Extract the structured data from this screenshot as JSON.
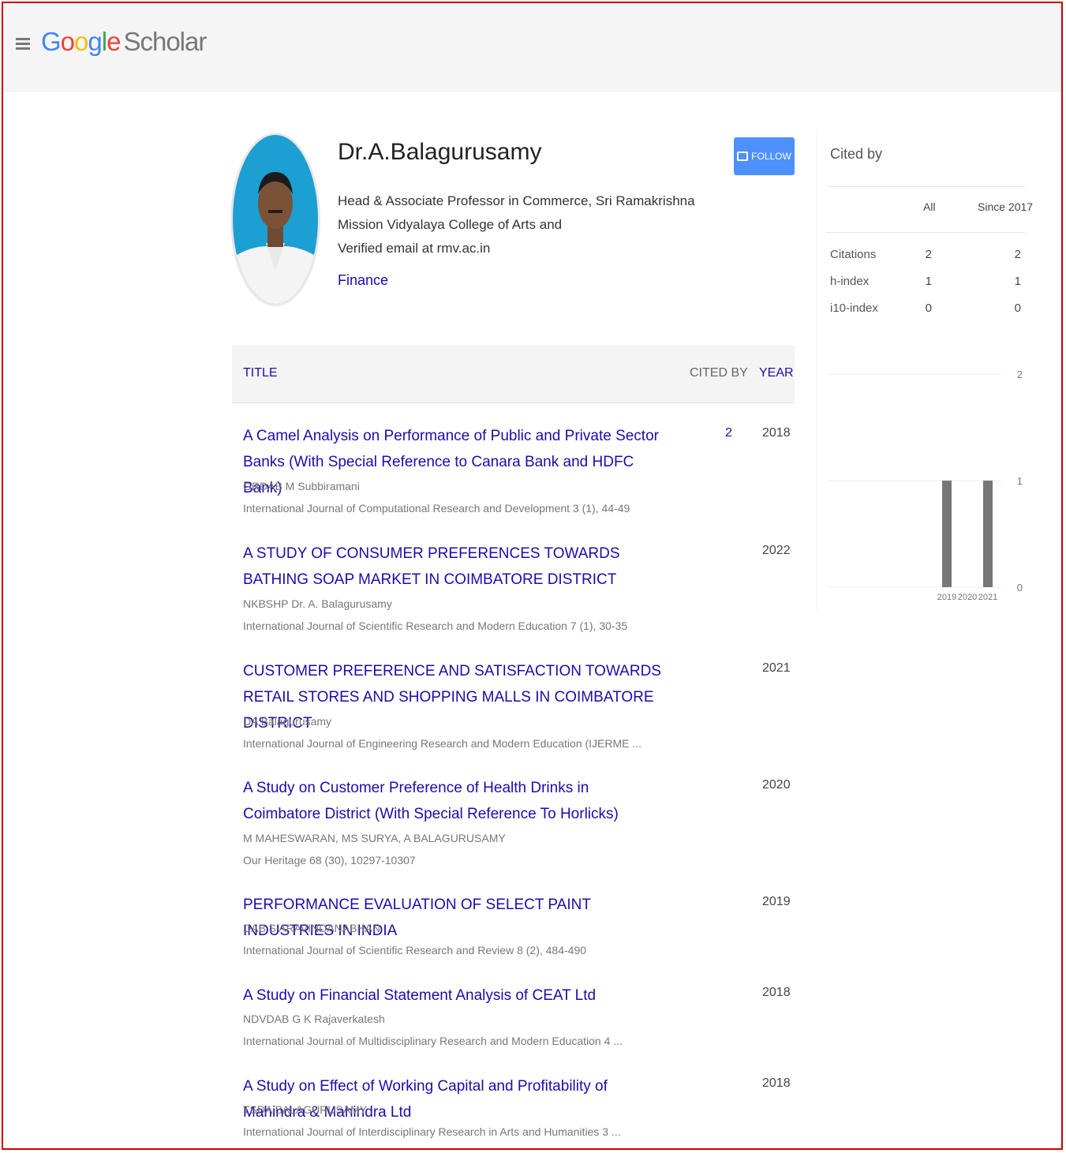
{
  "header": {
    "menu_icon": "hamburger-menu-icon",
    "logo_google": [
      "G",
      "o",
      "o",
      "g",
      "l",
      "e"
    ],
    "logo_scholar": "Scholar"
  },
  "profile": {
    "name": "Dr.A.Balagurusamy",
    "affiliation": "Head & Associate Professor in Commerce, Sri Ramakrishna Mission Vidyalaya College of Arts and",
    "email": "Verified email at rmv.ac.in",
    "interest": "Finance",
    "follow_label": "FOLLOW"
  },
  "table": {
    "col_title": "TITLE",
    "col_cited": "CITED BY",
    "col_year": "YEAR",
    "rows": [
      {
        "title": "A Camel Analysis on Performance of Public and Private Sector Banks (With Special Reference to Canara Bank and HDFC Bank)",
        "authors": "GRDAB M Subbiramani",
        "venue": "International Journal of Computational Research and Development 3 (1), 44-49",
        "cited": "2",
        "year": "2018"
      },
      {
        "title": "A STUDY OF CONSUMER PREFERENCES TOWARDS BATHING SOAP MARKET IN COIMBATORE DISTRICT",
        "authors": "NKBSHP Dr. A. Balagurusamy",
        "venue": "International Journal of Scientific Research and Modern Education 7 (1), 30-35",
        "cited": "",
        "year": "2022"
      },
      {
        "title": "CUSTOMER PREFERENCE AND SATISFACTION TOWARDS RETAIL STORES AND SHOPPING MALLS IN COIMBATORE DISTRICT",
        "authors": "DA Balagurusamy",
        "venue": "International Journal of Engineering Research and Modern Education (IJERME ...",
        "cited": "",
        "year": "2021"
      },
      {
        "title": "A Study on Customer Preference of Health Drinks in Coimbatore District (With Special Reference To Horlicks)",
        "authors": "M MAHESWARAN, MS SURYA, A BALAGURUSAMY",
        "venue": "Our Heritage 68 (30), 10297-10307",
        "cited": "",
        "year": "2020"
      },
      {
        "title": "PERFORMANCE EVALUATION OF SELECT PAINT INDUSTRIES IN INDIA",
        "authors": "DAB S ARAVINDANABHAN",
        "venue": "International Journal of Scientific Research and Review 8 (2), 484-490",
        "cited": "",
        "year": "2019"
      },
      {
        "title": "A Study on Financial Statement Analysis of CEAT Ltd",
        "authors": "NDVDAB G K Rajaverkatesh",
        "venue": "International Journal of Multidisciplinary Research and Modern Education 4 ...",
        "cited": "",
        "year": "2018"
      },
      {
        "title": "A Study on Effect of Working Capital and Profitability of Mahindra & Mahindra Ltd",
        "authors": "TSDA BALAGURUSAMY",
        "venue": "International Journal of Interdisciplinary Research in Arts and Humanities 3 ...",
        "cited": "",
        "year": "2018"
      }
    ]
  },
  "cited_by": {
    "title": "Cited by",
    "col_all": "All",
    "col_since": "Since 2017",
    "stats": [
      {
        "label": "Citations",
        "all": "2",
        "since": "2"
      },
      {
        "label": "h-index",
        "all": "1",
        "since": "1"
      },
      {
        "label": "i10-index",
        "all": "0",
        "since": "0"
      }
    ]
  },
  "chart_data": {
    "type": "bar",
    "categories": [
      "2019",
      "2020",
      "2021"
    ],
    "values": [
      1,
      0,
      1
    ],
    "ylim": [
      0,
      2
    ],
    "yticks": [
      "0",
      "1",
      "2"
    ],
    "grid": true
  }
}
